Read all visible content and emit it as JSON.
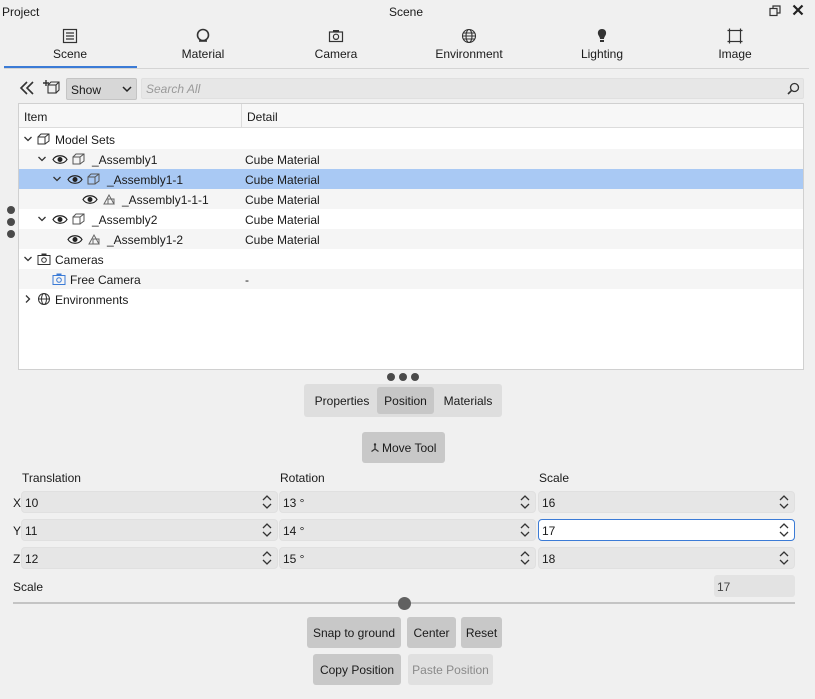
{
  "window": {
    "project_label": "Project",
    "title": "Scene"
  },
  "tabs": [
    {
      "label": "Scene",
      "icon": "scene-icon"
    },
    {
      "label": "Material",
      "icon": "material-icon"
    },
    {
      "label": "Camera",
      "icon": "camera-icon"
    },
    {
      "label": "Environment",
      "icon": "globe-icon"
    },
    {
      "label": "Lighting",
      "icon": "bulb-icon"
    },
    {
      "label": "Image",
      "icon": "image-frame-icon"
    }
  ],
  "active_tab": "Scene",
  "toolbar": {
    "show_value": "Show",
    "search_placeholder": "Search All"
  },
  "tree": {
    "columns": {
      "item": "Item",
      "detail": "Detail"
    },
    "rows": [
      {
        "label": "Model Sets",
        "detail": ""
      },
      {
        "label": "_Assembly1",
        "detail": "Cube Material"
      },
      {
        "label": "_Assembly1-1",
        "detail": "Cube Material",
        "selected": true
      },
      {
        "label": "_Assembly1-1-1",
        "detail": "Cube Material"
      },
      {
        "label": "_Assembly2",
        "detail": "Cube Material"
      },
      {
        "label": "_Assembly1-2",
        "detail": "Cube Material"
      },
      {
        "label": "Cameras",
        "detail": ""
      },
      {
        "label": "Free Camera",
        "detail": "-"
      },
      {
        "label": "Environments",
        "detail": ""
      }
    ]
  },
  "panel_tabs": {
    "properties": "Properties",
    "position": "Position",
    "materials": "Materials",
    "active": "Position"
  },
  "move_tool_label": "Move Tool",
  "transform": {
    "translation_label": "Translation",
    "rotation_label": "Rotation",
    "scale_label": "Scale",
    "axes": [
      "X",
      "Y",
      "Z"
    ],
    "translation": [
      "10",
      "11",
      "12"
    ],
    "rotation": [
      "13 °",
      "14 °",
      "15 °"
    ],
    "scale": [
      "16",
      "17",
      "18"
    ]
  },
  "uniform_scale": {
    "label": "Scale",
    "value": "17",
    "slider_fraction": 0.5
  },
  "buttons": {
    "snap_to_ground": "Snap to ground",
    "center": "Center",
    "reset": "Reset",
    "copy_position": "Copy Position",
    "paste_position": "Paste Position"
  },
  "colors": {
    "accent": "#3b7bd6",
    "selection": "#a9c9f4"
  }
}
